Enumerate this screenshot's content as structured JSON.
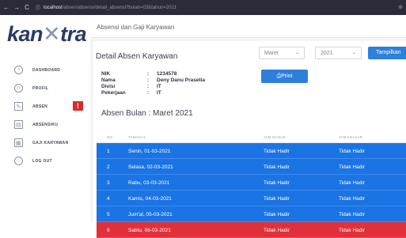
{
  "browser": {
    "url_host": "localhost",
    "url_path": "/absen/absensi/detail_absensi?bulan=03&tahun=2021",
    "back": "←",
    "forward": "→",
    "reload": "C",
    "secure_icon": "ⓘ",
    "right_icon": "⊕"
  },
  "brand": {
    "logo_a": "kan",
    "logo_x": "✕",
    "logo_b": "tra"
  },
  "sidebar": {
    "items": [
      {
        "label": "DASHBOARD",
        "icon": "◔"
      },
      {
        "label": "PROFIL",
        "icon": "☺"
      },
      {
        "label": "ABSEN",
        "icon": "✎",
        "badge": "!"
      },
      {
        "label": "ABSENSIKU",
        "icon": "▤"
      },
      {
        "label": "GAJI KARYAWAN",
        "icon": "▦"
      },
      {
        "label": "LOG OUT",
        "icon": "◌"
      }
    ]
  },
  "page": {
    "title": "Absensi dan Gaji Karyawan"
  },
  "detail": {
    "title": "Detail Absen Karyawan",
    "month_select": "Maret",
    "year_select": "2021",
    "show_button": "Tampilkan",
    "print_button": "⎙Print",
    "fields": [
      {
        "key": "NIK",
        "value": "1234578"
      },
      {
        "key": "Nama",
        "value": "Deny Danu Prasetia"
      },
      {
        "key": "Divisi",
        "value": "IT"
      },
      {
        "key": "Pekerjaan",
        "value": "IT"
      }
    ],
    "month_heading": "Absen Bulan : Maret 2021"
  },
  "table": {
    "headers": [
      "NO",
      "TANGGAL",
      "JAM MASUK",
      "JAM KELUAR"
    ],
    "rows": [
      {
        "no": "1",
        "date": "Senin, 01-03-2021",
        "in": "Tidak Hadir",
        "out": "Tidak Hadir",
        "status": "blue"
      },
      {
        "no": "2",
        "date": "Selasa, 02-03-2021",
        "in": "Tidak Hadir",
        "out": "Tidak Hadir",
        "status": "blue"
      },
      {
        "no": "3",
        "date": "Rabu, 03-03-2021",
        "in": "Tidak Hadir",
        "out": "Tidak Hadir",
        "status": "blue"
      },
      {
        "no": "4",
        "date": "Kamis, 04-03-2021",
        "in": "Tidak Hadir",
        "out": "Tidak Hadir",
        "status": "blue"
      },
      {
        "no": "5",
        "date": "Jum'at, 05-03-2021",
        "in": "Tidak Hadir",
        "out": "Tidak Hadir",
        "status": "blue"
      },
      {
        "no": "6",
        "date": "Sabtu, 06-03-2021",
        "in": "Tidak Hadir",
        "out": "Tidak Hadir",
        "status": "red"
      }
    ]
  },
  "colors": {
    "primary": "#1b74e4",
    "danger": "#e0313a",
    "urlbar": "#2b2c3a"
  }
}
